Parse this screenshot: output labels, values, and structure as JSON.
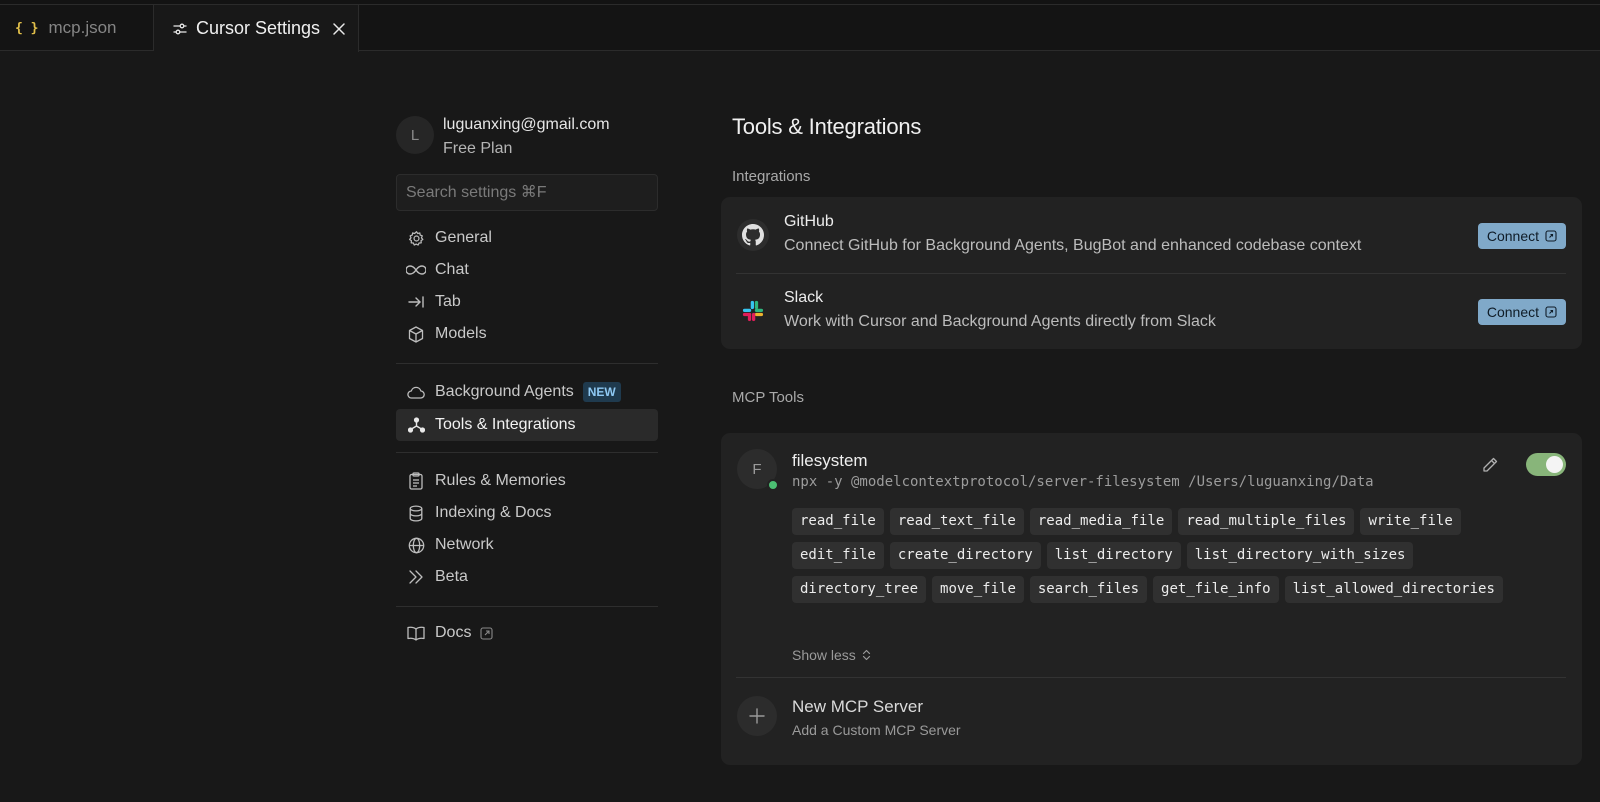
{
  "tabs": [
    {
      "icon": "braces-icon",
      "glyph": "{ }",
      "label": "mcp.json"
    },
    {
      "icon": "settings-sliders-icon",
      "label": "Cursor Settings"
    }
  ],
  "profile": {
    "initial": "L",
    "email": "luguanxing@gmail.com",
    "plan": "Free Plan"
  },
  "search": {
    "placeholder": "Search settings ⌘F"
  },
  "sidebar": {
    "general": "General",
    "chat": "Chat",
    "tab": "Tab",
    "models": "Models",
    "background_agents": "Background Agents",
    "new_badge": "NEW",
    "tools": "Tools & Integrations",
    "rules": "Rules & Memories",
    "indexing": "Indexing & Docs",
    "network": "Network",
    "beta": "Beta",
    "docs": "Docs"
  },
  "main": {
    "title": "Tools & Integrations",
    "integrations_label": "Integrations",
    "integrations": [
      {
        "name": "GitHub",
        "description": "Connect GitHub for Background Agents, BugBot and enhanced codebase context",
        "button": "Connect"
      },
      {
        "name": "Slack",
        "description": "Work with Cursor and Background Agents directly from Slack",
        "button": "Connect"
      }
    ],
    "mcp_label": "MCP Tools",
    "server": {
      "initial": "F",
      "name": "filesystem",
      "command": "npx -y @modelcontextprotocol/server-filesystem /Users/luguanxing/Data",
      "enabled": true,
      "tools": [
        "read_file",
        "read_text_file",
        "read_media_file",
        "read_multiple_files",
        "write_file",
        "edit_file",
        "create_directory",
        "list_directory",
        "list_directory_with_sizes",
        "directory_tree",
        "move_file",
        "search_files",
        "get_file_info",
        "list_allowed_directories"
      ],
      "show_less": "Show less"
    },
    "new_server": {
      "title": "New MCP Server",
      "subtitle": "Add a Custom MCP Server"
    }
  },
  "colors": {
    "background": "#181818",
    "card": "#222222",
    "connect_button": "#80a9c9",
    "toggle_on": "#88b57a",
    "status_online": "#4cbf73",
    "new_badge": "#8ec8f2"
  }
}
